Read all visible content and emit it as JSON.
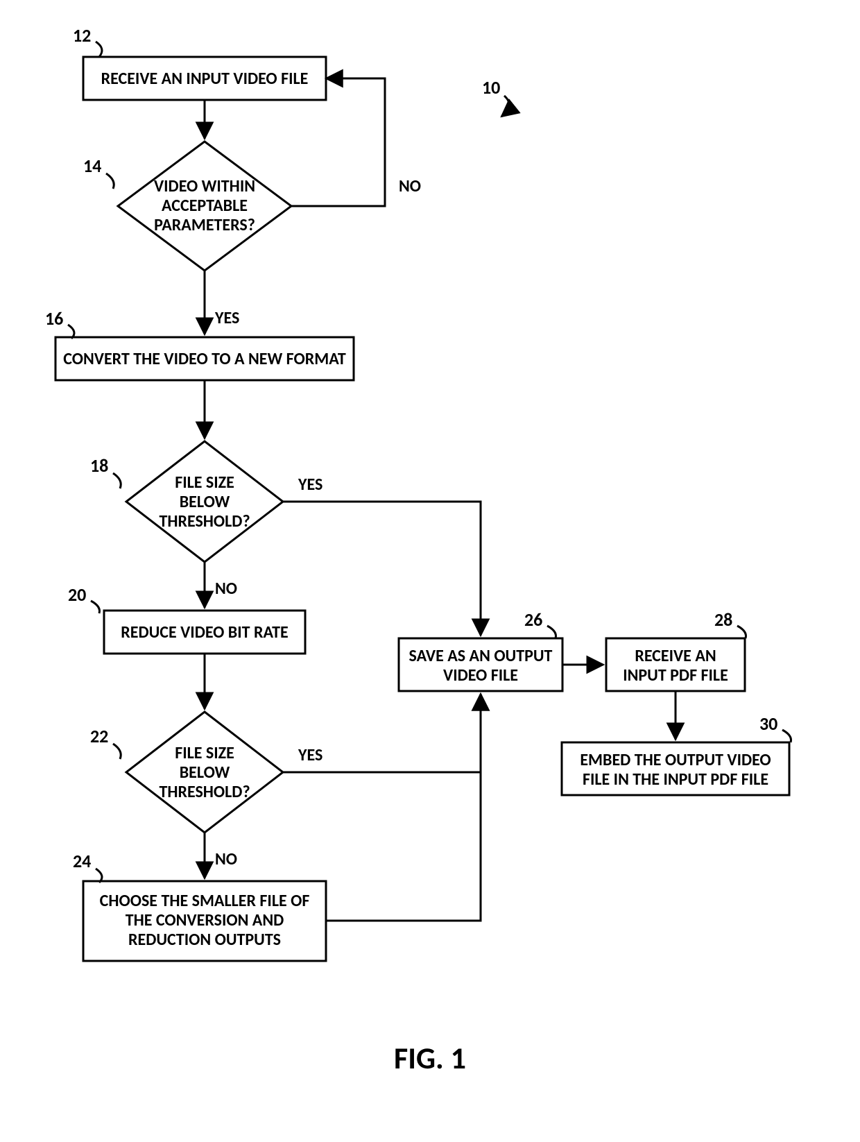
{
  "figure_title": "FIG. 1",
  "nodes": {
    "n12": {
      "ref": "12",
      "text": "RECEIVE AN INPUT VIDEO FILE"
    },
    "n14": {
      "ref": "14",
      "lines": [
        "VIDEO WITHIN",
        "ACCEPTABLE",
        "PARAMETERS?"
      ]
    },
    "n16": {
      "ref": "16",
      "text": "CONVERT THE VIDEO TO A NEW FORMAT"
    },
    "n18": {
      "ref": "18",
      "lines": [
        "FILE SIZE",
        "BELOW",
        "THRESHOLD?"
      ]
    },
    "n20": {
      "ref": "20",
      "text": "REDUCE VIDEO BIT RATE"
    },
    "n22": {
      "ref": "22",
      "lines": [
        "FILE SIZE",
        "BELOW",
        "THRESHOLD?"
      ]
    },
    "n24": {
      "ref": "24",
      "lines": [
        "CHOOSE THE SMALLER FILE OF",
        "THE CONVERSION AND",
        "REDUCTION OUTPUTS"
      ]
    },
    "n26": {
      "ref": "26",
      "lines": [
        "SAVE AS AN OUTPUT",
        "VIDEO FILE"
      ]
    },
    "n28": {
      "ref": "28",
      "lines": [
        "RECEIVE AN",
        "INPUT PDF FILE"
      ]
    },
    "n30": {
      "ref": "30",
      "lines": [
        "EMBED THE OUTPUT VIDEO",
        "FILE IN THE INPUT PDF FILE"
      ]
    }
  },
  "misc_refs": {
    "n10": "10"
  },
  "edge_labels": {
    "yes": "YES",
    "no": "NO"
  }
}
